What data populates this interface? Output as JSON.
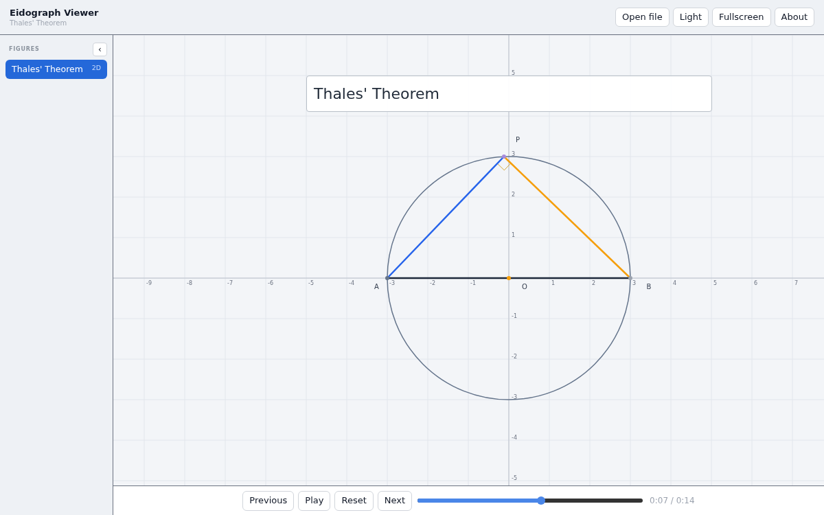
{
  "header": {
    "title": "Eidograph Viewer",
    "subtitle": "Thales' Theorem",
    "buttons": [
      "Open file",
      "Light",
      "Fullscreen",
      "About"
    ]
  },
  "sidebar": {
    "heading": "FIGURES",
    "collapse": "‹",
    "items": [
      {
        "label": "Thales' Theorem",
        "badge": "2D",
        "selected": true
      }
    ]
  },
  "canvas": {
    "title": "Thales' Theorem",
    "x_ticks": [
      "-9",
      "-8",
      "-7",
      "-6",
      "-5",
      "-4",
      "-3",
      "-2",
      "-1",
      "1",
      "2",
      "3",
      "4",
      "5",
      "6",
      "7"
    ],
    "y_ticks": [
      "5",
      "3",
      "2",
      "1",
      "-1",
      "-2",
      "-3",
      "-4",
      "-5"
    ],
    "segments": [
      {
        "color": "#2563eb"
      },
      {
        "color": "#f59e0b"
      },
      {
        "color": "#1e293b"
      }
    ],
    "points": [
      {
        "label": "A",
        "color": "#64748b"
      },
      {
        "label": "O",
        "color": "#f59e0b"
      },
      {
        "label": "B",
        "color": "#9ca3af"
      },
      {
        "label": "P",
        "color": "#a78bdb"
      }
    ]
  },
  "player": {
    "buttons": [
      "Previous",
      "Play",
      "Reset",
      "Next"
    ],
    "level": 0.55,
    "time": "0:07 / 0:14"
  }
}
